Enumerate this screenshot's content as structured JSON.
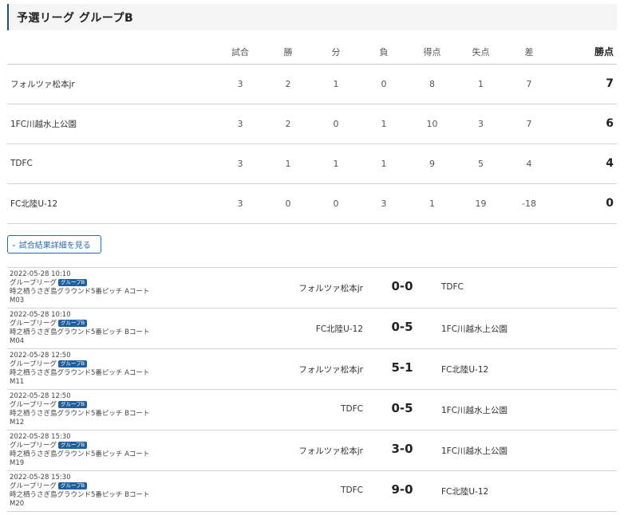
{
  "header": {
    "title": "予選リーグ グループB"
  },
  "standings": {
    "columns": [
      "試合",
      "勝",
      "分",
      "負",
      "得点",
      "失点",
      "差",
      "勝点"
    ],
    "rows": [
      {
        "team": "フォルツァ松本jr",
        "played": "3",
        "won": "2",
        "drawn": "1",
        "lost": "0",
        "gf": "8",
        "ga": "1",
        "diff": "7",
        "points": "7"
      },
      {
        "team": "1FC川越水上公園",
        "played": "3",
        "won": "2",
        "drawn": "0",
        "lost": "1",
        "gf": "10",
        "ga": "3",
        "diff": "7",
        "points": "6"
      },
      {
        "team": "TDFC",
        "played": "3",
        "won": "1",
        "drawn": "1",
        "lost": "1",
        "gf": "9",
        "ga": "5",
        "diff": "4",
        "points": "4"
      },
      {
        "team": "FC北陸U-12",
        "played": "3",
        "won": "0",
        "drawn": "0",
        "lost": "3",
        "gf": "1",
        "ga": "19",
        "diff": "-18",
        "points": "0"
      }
    ]
  },
  "detail_button": {
    "label": "試合結果詳細を見る",
    "icon": "chevron-down-icon"
  },
  "matches": [
    {
      "datetime": "2022-05-28 10:10",
      "stage": "グループリーグ",
      "badge": "グループB",
      "venue": "時之栖うさぎ島グラウンド5番ピッチ Aコート",
      "code": "M03",
      "home": "フォルツァ松本jr",
      "score": "0-0",
      "away": "TDFC"
    },
    {
      "datetime": "2022-05-28 10:10",
      "stage": "グループリーグ",
      "badge": "グループB",
      "venue": "時之栖うさぎ島グラウンド5番ピッチ Bコート",
      "code": "M04",
      "home": "FC北陸U-12",
      "score": "0-5",
      "away": "1FC川越水上公園"
    },
    {
      "datetime": "2022-05-28 12:50",
      "stage": "グループリーグ",
      "badge": "グループB",
      "venue": "時之栖うさぎ島グラウンド5番ピッチ Aコート",
      "code": "M11",
      "home": "フォルツァ松本jr",
      "score": "5-1",
      "away": "FC北陸U-12"
    },
    {
      "datetime": "2022-05-28 12:50",
      "stage": "グループリーグ",
      "badge": "グループB",
      "venue": "時之栖うさぎ島グラウンド5番ピッチ Bコート",
      "code": "M12",
      "home": "TDFC",
      "score": "0-5",
      "away": "1FC川越水上公園"
    },
    {
      "datetime": "2022-05-28 15:30",
      "stage": "グループリーグ",
      "badge": "グループB",
      "venue": "時之栖うさぎ島グラウンド5番ピッチ Aコート",
      "code": "M19",
      "home": "フォルツァ松本jr",
      "score": "3-0",
      "away": "1FC川越水上公園"
    },
    {
      "datetime": "2022-05-28 15:30",
      "stage": "グループリーグ",
      "badge": "グループB",
      "venue": "時之栖うさぎ島グラウンド5番ピッチ Bコート",
      "code": "M20",
      "home": "TDFC",
      "score": "9-0",
      "away": "FC北陸U-12"
    }
  ]
}
